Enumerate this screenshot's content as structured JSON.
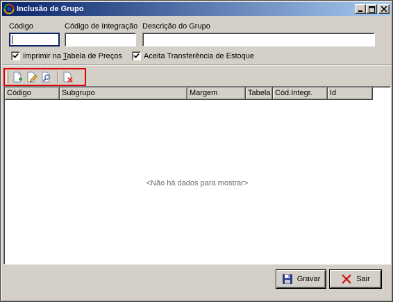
{
  "window": {
    "title": "Inclusão de Grupo",
    "controls": [
      "minimize-icon",
      "maximize-icon",
      "close-icon"
    ]
  },
  "form": {
    "codigo_label": "Código",
    "codigo_value": "",
    "codigo_integracao_label": "Código de Integração",
    "codigo_integracao_value": "",
    "descricao_label": "Descrição do Grupo",
    "descricao_value": "",
    "imprimir_label_pre": "Imprimir na ",
    "imprimir_label_underline": "T",
    "imprimir_label_post": "abela de Preços",
    "imprimir_checked": true,
    "aceita_label": "Aceita Transferência de Estoque",
    "aceita_checked": true
  },
  "toolbar": {
    "tools": [
      "new-icon",
      "edit-icon",
      "search-icon",
      "delete-icon"
    ]
  },
  "grid": {
    "columns": [
      "Código",
      "Subgrupo",
      "Margem",
      "Tabela",
      "Cód.Integr.",
      "Id"
    ],
    "rows": [],
    "empty_message": "<Não há dados para mostrar>"
  },
  "buttons": {
    "gravar": "Gravar",
    "sair": "Sair"
  },
  "colors": {
    "title_start": "#0a246a",
    "title_end": "#a6caf0",
    "highlight": "#e00000",
    "face": "#d4d0c8"
  }
}
